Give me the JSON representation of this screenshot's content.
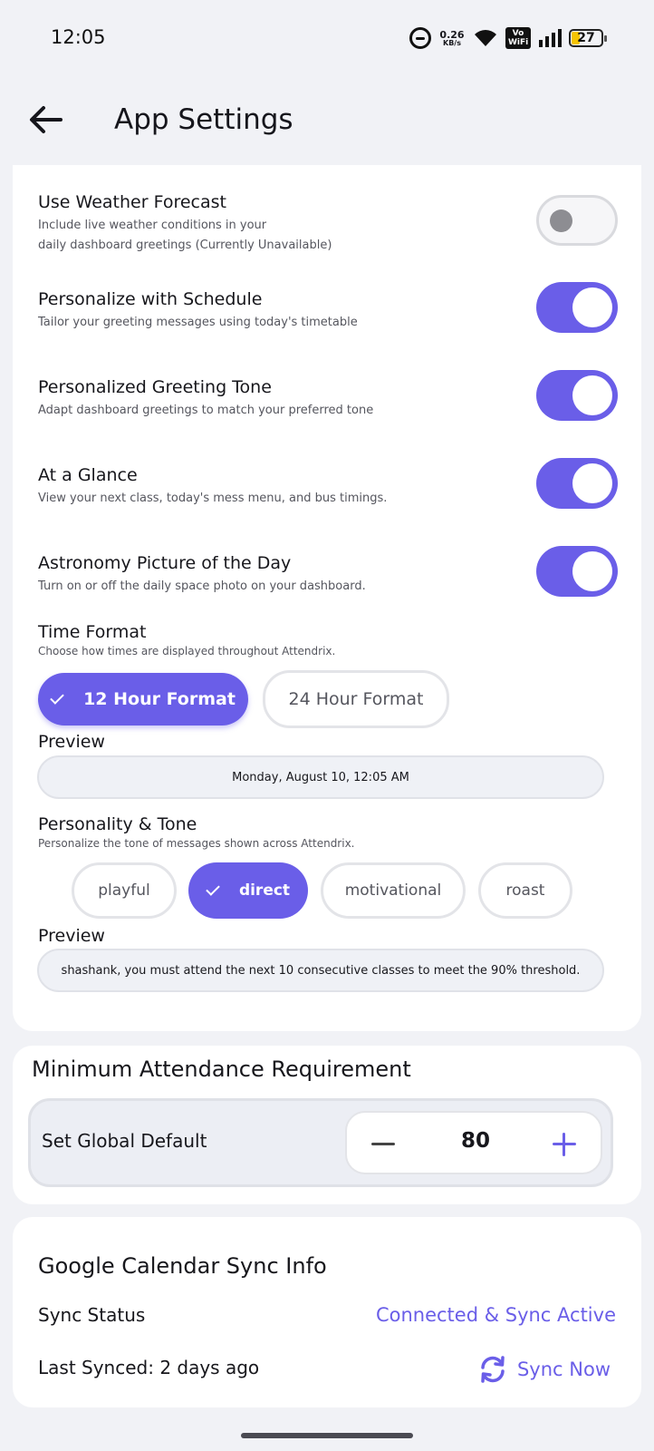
{
  "status_bar": {
    "time": "12:05",
    "net_speed_value": "0.26",
    "net_speed_unit": "KB/s",
    "vowifi_top": "Vo",
    "vowifi_bottom": "WiFi",
    "battery": "27",
    "battery_color": "#f5c400"
  },
  "header": {
    "title": "App Settings",
    "back_icon": "arrow-left-icon"
  },
  "settings": [
    {
      "title": "Use Weather Forecast",
      "desc_line1": "Include live weather conditions in your",
      "desc_line2": "daily dashboard greetings (Currently Unavailable)",
      "enabled": false
    },
    {
      "title": "Personalize with Schedule",
      "desc_line1": "Tailor your greeting messages using today's timetable",
      "enabled": true
    },
    {
      "title": "Personalized Greeting Tone",
      "desc_line1": "Adapt dashboard greetings to match your preferred tone",
      "enabled": true
    },
    {
      "title": "At a Glance",
      "desc_line1": "View your next class, today's mess menu, and bus timings.",
      "enabled": true
    },
    {
      "title": "Astronomy Picture of the Day",
      "desc_line1": "Turn on or off the daily space photo on your dashboard.",
      "enabled": true
    }
  ],
  "time_format": {
    "title": "Time Format",
    "desc": "Choose how times are displayed throughout Attendrix.",
    "options": [
      "12 Hour Format",
      "24 Hour Format"
    ],
    "selected": "12 Hour Format",
    "preview_label": "Preview",
    "preview_value": "Monday, August 10, 12:05 AM"
  },
  "personality": {
    "title": "Personality & Tone",
    "desc": "Personalize the tone of messages shown across Attendrix.",
    "options": [
      "playful",
      "direct",
      "motivational",
      "roast"
    ],
    "selected": "direct",
    "preview_label": "Preview",
    "preview_value": "shashank, you must attend the next 10 consecutive classes to meet the 90% threshold."
  },
  "attendance": {
    "title": "Minimum Attendance Requirement",
    "label": "Set Global Default",
    "value": "80"
  },
  "calendar": {
    "title": "Google Calendar Sync Info",
    "status_label": "Sync Status",
    "status_value": "Connected & Sync Active",
    "last_synced": "Last Synced: 2 days ago",
    "sync_button": "Sync Now"
  },
  "colors": {
    "accent": "#6a5ee8",
    "background": "#f1f2f6",
    "card": "#ffffff"
  }
}
